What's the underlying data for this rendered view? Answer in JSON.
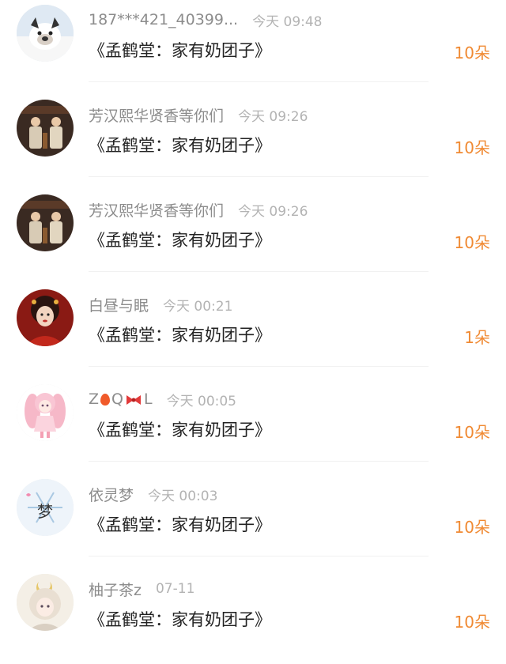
{
  "rows": [
    {
      "user": "187***421_40399...",
      "time": "今天 09:48",
      "gift": "《孟鹤堂：家有奶团子》",
      "count": "10朵",
      "avatar": "dog-avatar"
    },
    {
      "user": "芳汉熙华贤香等你们",
      "time": "今天 09:26",
      "gift": "《孟鹤堂：家有奶团子》",
      "count": "10朵",
      "avatar": "stage-duo-avatar"
    },
    {
      "user": "芳汉熙华贤香等你们",
      "time": "今天 09:26",
      "gift": "《孟鹤堂：家有奶团子》",
      "count": "10朵",
      "avatar": "stage-duo-avatar"
    },
    {
      "user": "白昼与眠",
      "time": "今天 00:21",
      "gift": "《孟鹤堂：家有奶团子》",
      "count": "1朵",
      "avatar": "red-portrait-avatar"
    },
    {
      "user_parts": [
        "Z",
        "Q",
        "L"
      ],
      "time": "今天 00:05",
      "gift": "《孟鹤堂：家有奶团子》",
      "count": "10朵",
      "avatar": "pink-anime-avatar"
    },
    {
      "user": "依灵梦",
      "time": "今天 00:03",
      "gift": "《孟鹤堂：家有奶团子》",
      "count": "10朵",
      "avatar": "snowflake-avatar",
      "avatar_text": "梦"
    },
    {
      "user": "柚子茶z",
      "time": "07-11",
      "gift": "《孟鹤堂：家有奶团子》",
      "count": "10朵",
      "avatar": "moon-girl-avatar"
    }
  ],
  "colors": {
    "username": "#8c8c8c",
    "time": "#b3b3b3",
    "gift": "#222222",
    "count": "#f08a33"
  },
  "icons": [
    "balloon-emoji",
    "bow-emoji"
  ]
}
